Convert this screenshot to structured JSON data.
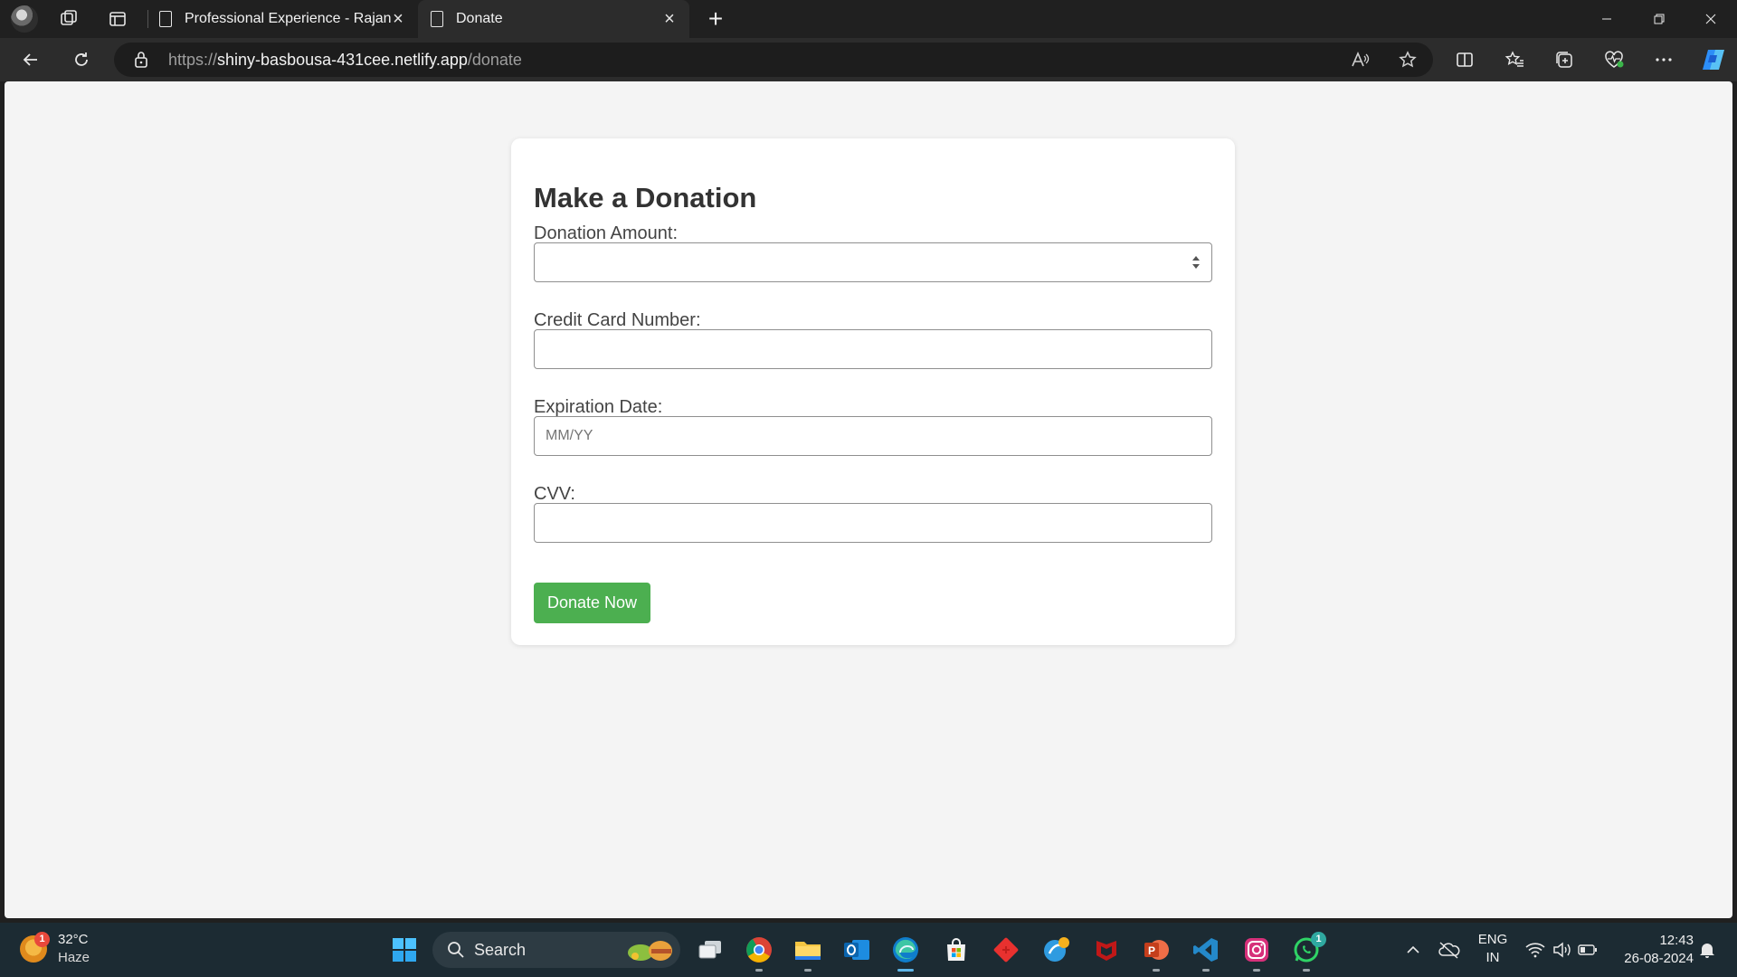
{
  "browser": {
    "tabs": [
      {
        "title": "Professional Experience - Rajan",
        "active": false
      },
      {
        "title": "Donate",
        "active": true
      }
    ],
    "address": {
      "scheme": "https://",
      "host": "shiny-basbousa-431cee.netlify.app",
      "path": "/donate"
    },
    "icons": {
      "back": "back-arrow-icon",
      "refresh": "refresh-icon",
      "lock": "lock-icon",
      "read_aloud": "read-aloud-icon",
      "favorite": "star-icon",
      "split": "split-screen-icon",
      "favorites": "favorites-icon",
      "collections": "collections-icon",
      "performance": "heart-pulse-icon",
      "menu": "more-icon",
      "copilot": "copilot-icon"
    }
  },
  "page": {
    "heading": "Make a Donation",
    "fields": {
      "amount_label": "Donation Amount:",
      "amount_value": "",
      "card_label": "Credit Card Number:",
      "card_value": "",
      "expiry_label": "Expiration Date:",
      "expiry_placeholder": "MM/YY",
      "cvv_label": "CVV:",
      "cvv_value": ""
    },
    "submit_label": "Donate Now",
    "colors": {
      "accent": "#4caf50",
      "background": "#f4f4f4",
      "card": "#ffffff"
    }
  },
  "taskbar": {
    "weather": {
      "badge": "1",
      "temperature": "32°C",
      "condition": "Haze"
    },
    "search_label": "Search",
    "apps": [
      "task-view-icon",
      "chrome-icon",
      "file-explorer-icon",
      "outlook-icon",
      "edge-icon",
      "store-icon",
      "git-icon",
      "app-icon",
      "mcafee-icon",
      "powerpoint-icon",
      "vscode-icon",
      "instagram-icon",
      "whatsapp-icon"
    ],
    "whatsapp_badge": "1",
    "tray": {
      "language": "ENG",
      "region": "IN",
      "time": "12:43",
      "date": "26-08-2024"
    }
  }
}
